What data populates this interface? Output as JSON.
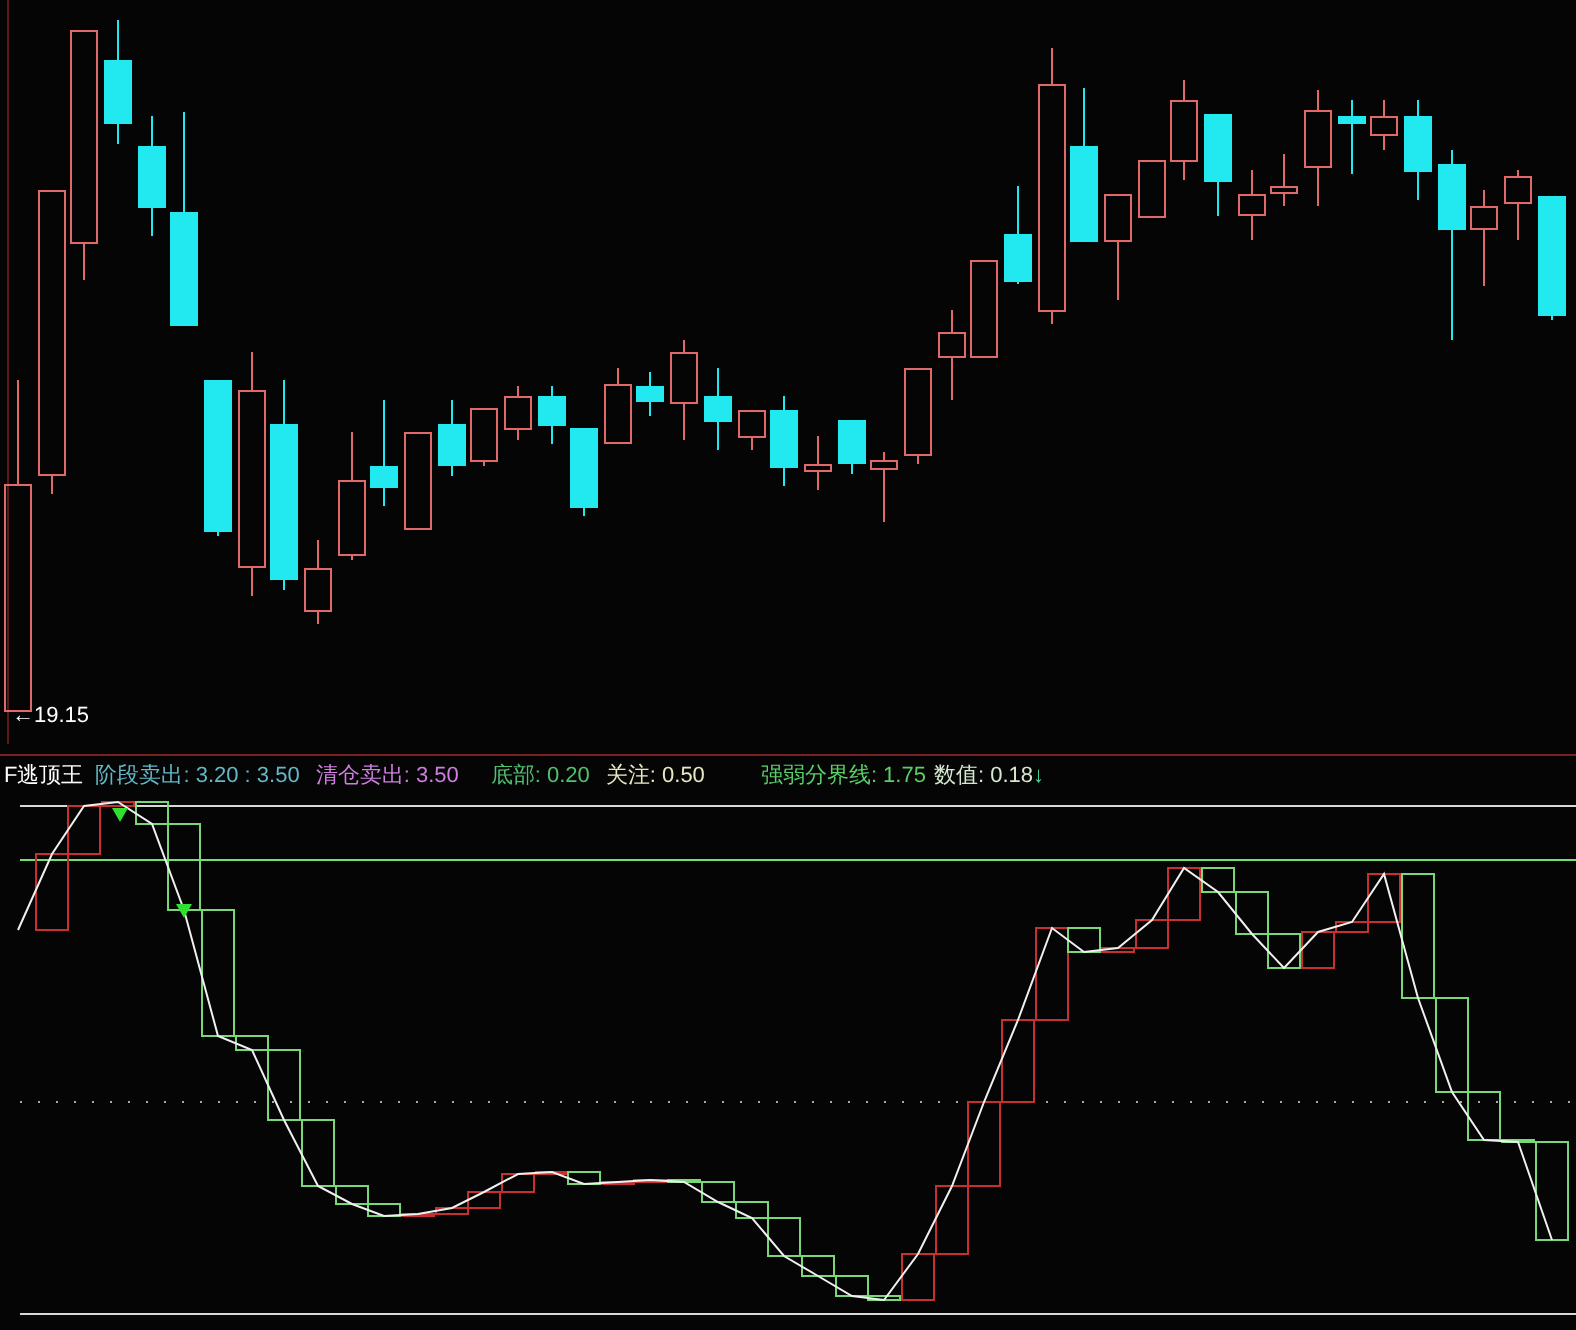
{
  "price_chart": {
    "price_label": "←19.15"
  },
  "indicator": {
    "name": "F逃顶王",
    "legend": [
      {
        "label": "阶段卖出:",
        "value": "3.20 : 3.50",
        "color": "#62b8c8"
      },
      {
        "label": "清仓卖出:",
        "value": "3.50",
        "color": "#d07ee0"
      },
      {
        "label": "底部:",
        "value": "0.20",
        "color": "#50c070"
      },
      {
        "label": "关注:",
        "value": "0.50",
        "color": "#e8e8c0"
      },
      {
        "label": "强弱分界线:",
        "value": "1.75",
        "color": "#58d068"
      },
      {
        "label": "数值:",
        "value": "0.18",
        "color": "#d8e8d0"
      }
    ],
    "signal_arrow": "↓"
  }
}
